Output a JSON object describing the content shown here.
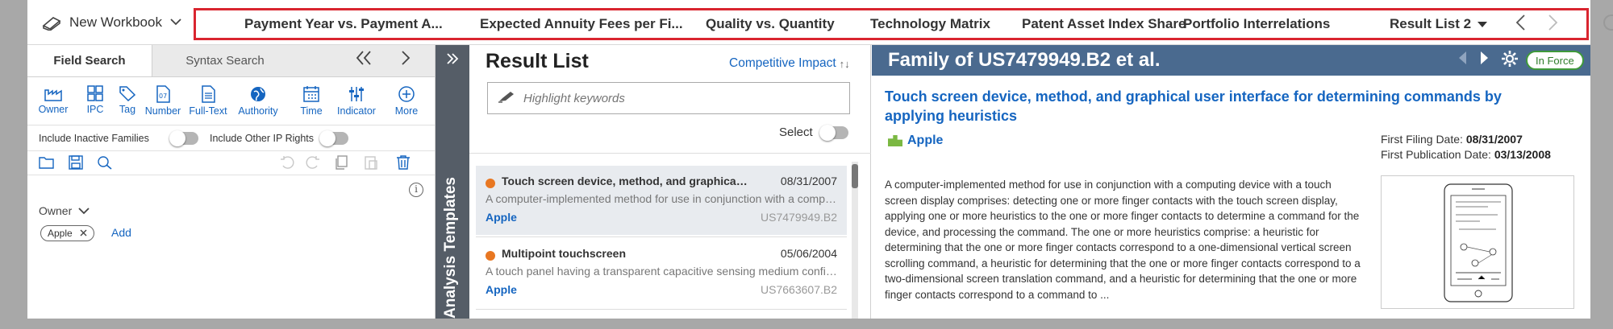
{
  "workbook": {
    "label": "New Workbook"
  },
  "tabs": [
    "Payment Year vs. Payment A...",
    "Expected Annuity Fees per Fi...",
    "Quality vs. Quantity",
    "Technology Matrix",
    "Patent Asset Index Share",
    "Portfolio Interrelations",
    "Result List 2"
  ],
  "left_panel": {
    "tabs": {
      "active": "Field Search",
      "other": "Syntax Search"
    },
    "tools": [
      "Owner",
      "IPC",
      "Tag",
      "Number",
      "Full-Text",
      "Authority",
      "Time",
      "Indicator",
      "More"
    ],
    "toggles": {
      "inactive": "Include Inactive Families",
      "other_ip": "Include Other IP Rights"
    },
    "owner_label": "Owner",
    "chip": "Apple",
    "add_label": "Add"
  },
  "strip": {
    "label": "Analysis Templates"
  },
  "result_list": {
    "title": "Result List",
    "sort_label": "Competitive Impact",
    "search_placeholder": "Highlight keywords",
    "select_label": "Select",
    "items": [
      {
        "title": "Touch screen device, method, and graphical user interface for determining commands by applying heuristics",
        "date": "08/31/2007",
        "desc": "A computer-implemented method for use in conjunction with a computing device with a touch screen display comprises",
        "owner": "Apple",
        "number": "US7479949.B2"
      },
      {
        "title": "Multipoint touchscreen",
        "date": "05/06/2004",
        "desc": "A touch panel having a transparent capacitive sensing medium configured to detect multiple touches",
        "owner": "Apple",
        "number": "US7663607.B2"
      }
    ]
  },
  "detail": {
    "header": "Family of US7479949.B2 et al.",
    "status": "In Force",
    "title": "Touch screen device, method, and graphical user interface for determining commands by applying heuristics",
    "owner": "Apple",
    "first_filing_label": "First Filing Date:",
    "first_filing": "08/31/2007",
    "first_pub_label": "First Publication Date:",
    "first_pub": "03/13/2008",
    "abstract": "A computer-implemented method for use in conjunction with a computing device with a touch screen display comprises: detecting one or more finger contacts with the touch screen display, applying one or more heuristics to the one or more finger contacts to determine a command for the device, and processing the command. The one or more heuristics comprise: a heuristic for determining that the one or more finger contacts correspond to a one-dimensional vertical screen scrolling command, a heuristic for determining that the one or more finger contacts correspond to a two-dimensional screen translation command, and a heuristic for determining that the one or more finger contacts correspond to a command to ..."
  },
  "colors": {
    "highlight_border": "#d9252f",
    "header_blue": "#4a6a8f",
    "link_blue": "#1565c0",
    "status_green": "#3f9a3a",
    "dot_orange": "#e87722"
  }
}
